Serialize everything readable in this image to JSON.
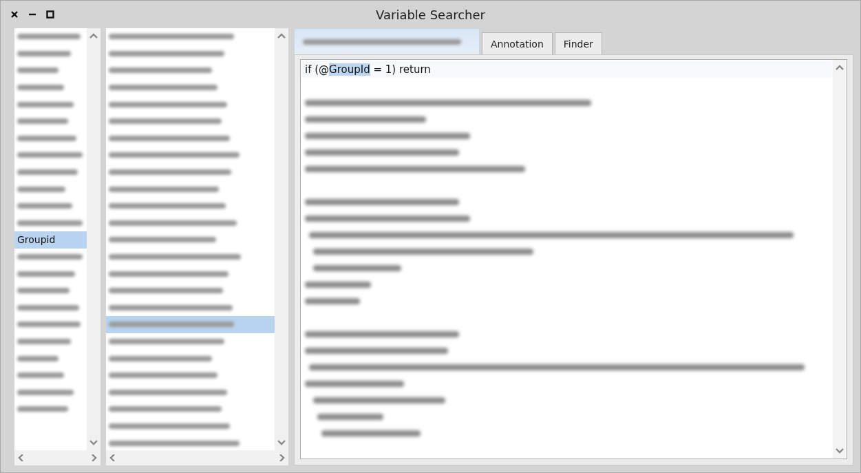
{
  "window": {
    "title": "Variable Searcher"
  },
  "variables": {
    "items": [
      {
        "kind": "blurred",
        "selected": false
      },
      {
        "kind": "blurred",
        "selected": false
      },
      {
        "kind": "blurred",
        "selected": false
      },
      {
        "kind": "blurred",
        "selected": false
      },
      {
        "kind": "blurred",
        "selected": false
      },
      {
        "kind": "blurred",
        "selected": false
      },
      {
        "kind": "blurred",
        "selected": false
      },
      {
        "kind": "blurred",
        "selected": false
      },
      {
        "kind": "blurred",
        "selected": false
      },
      {
        "kind": "blurred",
        "selected": false
      },
      {
        "kind": "blurred",
        "selected": false
      },
      {
        "kind": "blurred",
        "selected": false
      },
      {
        "kind": "text",
        "label": "Groupid",
        "selected": true
      },
      {
        "kind": "blurred",
        "selected": false
      },
      {
        "kind": "blurred",
        "selected": false
      },
      {
        "kind": "blurred",
        "selected": false
      },
      {
        "kind": "blurred",
        "selected": false
      },
      {
        "kind": "blurred",
        "selected": false
      },
      {
        "kind": "blurred",
        "selected": false
      },
      {
        "kind": "blurred",
        "selected": false
      },
      {
        "kind": "blurred",
        "selected": false
      },
      {
        "kind": "blurred",
        "selected": false
      },
      {
        "kind": "blurred",
        "selected": false
      }
    ]
  },
  "scripts": {
    "items": [
      {
        "kind": "blurred",
        "selected": false
      },
      {
        "kind": "blurred",
        "selected": false
      },
      {
        "kind": "blurred",
        "selected": false
      },
      {
        "kind": "blurred",
        "selected": false
      },
      {
        "kind": "blurred",
        "selected": false
      },
      {
        "kind": "blurred",
        "selected": false
      },
      {
        "kind": "blurred",
        "selected": false
      },
      {
        "kind": "blurred",
        "selected": false
      },
      {
        "kind": "blurred",
        "selected": false
      },
      {
        "kind": "blurred",
        "selected": false
      },
      {
        "kind": "blurred",
        "selected": false
      },
      {
        "kind": "blurred",
        "selected": false
      },
      {
        "kind": "blurred",
        "selected": false
      },
      {
        "kind": "blurred",
        "selected": false
      },
      {
        "kind": "blurred",
        "selected": false
      },
      {
        "kind": "blurred",
        "selected": false
      },
      {
        "kind": "blurred",
        "selected": false
      },
      {
        "kind": "blurred",
        "selected": true
      },
      {
        "kind": "blurred",
        "selected": false
      },
      {
        "kind": "blurred",
        "selected": false
      },
      {
        "kind": "blurred",
        "selected": false
      },
      {
        "kind": "blurred",
        "selected": false
      },
      {
        "kind": "blurred",
        "selected": false
      },
      {
        "kind": "blurred",
        "selected": false
      },
      {
        "kind": "blurred",
        "selected": false
      }
    ]
  },
  "tabs": [
    {
      "kind": "blurred",
      "selected": true
    },
    {
      "kind": "text",
      "label": "Annotation",
      "selected": false
    },
    {
      "kind": "text",
      "label": "Finder",
      "selected": false
    }
  ],
  "editor": {
    "lines": [
      {
        "kind": "text",
        "segments": [
          {
            "text": "if (@",
            "highlighted": false
          },
          {
            "text": "GroupId",
            "highlighted": true
          },
          {
            "text": " = 1) return",
            "highlighted": false
          }
        ]
      },
      {
        "kind": "blank"
      },
      {
        "kind": "blurred"
      },
      {
        "kind": "blurred"
      },
      {
        "kind": "blurred"
      },
      {
        "kind": "blurred"
      },
      {
        "kind": "blurred"
      },
      {
        "kind": "blank"
      },
      {
        "kind": "blurred"
      },
      {
        "kind": "blurred"
      },
      {
        "kind": "blurred"
      },
      {
        "kind": "blurred"
      },
      {
        "kind": "blurred"
      },
      {
        "kind": "blurred"
      },
      {
        "kind": "blurred"
      },
      {
        "kind": "blank"
      },
      {
        "kind": "blurred"
      },
      {
        "kind": "blurred"
      },
      {
        "kind": "blurred"
      },
      {
        "kind": "blurred"
      },
      {
        "kind": "blurred"
      },
      {
        "kind": "blurred"
      },
      {
        "kind": "blurred"
      }
    ]
  }
}
